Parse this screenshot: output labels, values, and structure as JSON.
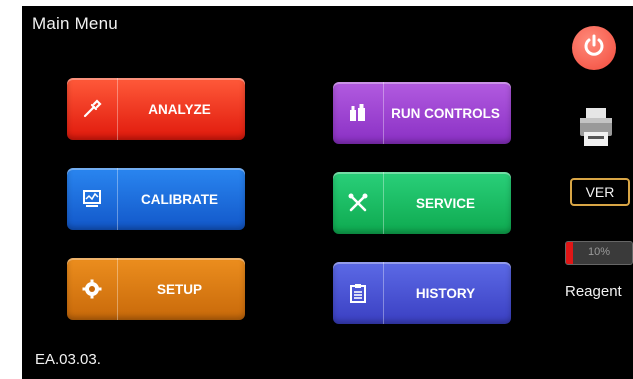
{
  "header": {
    "title": "Main Menu"
  },
  "buttons": {
    "analyze": "ANALYZE",
    "calibrate": "CALIBRATE",
    "setup": "SETUP",
    "run_controls": "RUN CONTROLS",
    "service": "SERVICE",
    "history": "HISTORY"
  },
  "side": {
    "ver_label": "VER",
    "reagent_percent": "10%",
    "reagent_level": 0.1,
    "reagent_label": "Reagent"
  },
  "footer": {
    "version": "EA.03.03."
  },
  "icons": {
    "power": "power-icon",
    "printer": "printer-icon",
    "analyze": "pipette-icon",
    "calibrate": "monitor-icon",
    "setup": "gear-icon",
    "run_controls": "bottles-icon",
    "service": "tools-icon",
    "history": "clipboard-icon"
  },
  "colors": {
    "analyze": "#e0190c",
    "calibrate": "#1257c9",
    "setup": "#c8690a",
    "run_controls": "#8a30c4",
    "service": "#0ea94f",
    "history": "#3a3fc2",
    "power": "#f24b3c",
    "ver_border": "#d9a646"
  }
}
